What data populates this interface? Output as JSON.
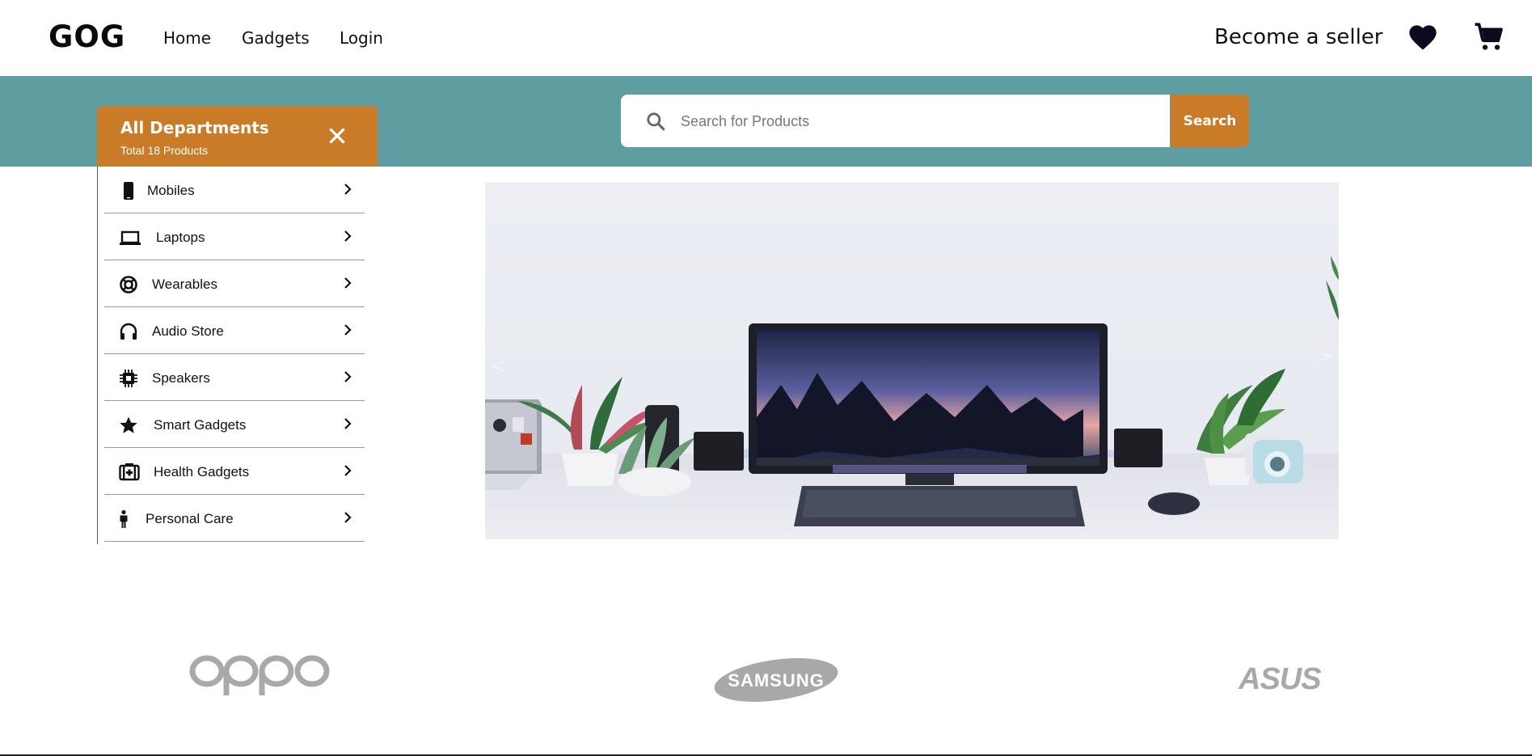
{
  "header": {
    "logo": "GOG",
    "nav": [
      {
        "label": "Home"
      },
      {
        "label": "Gadgets"
      },
      {
        "label": "Login"
      }
    ],
    "seller_label": "Become a seller",
    "icons": [
      "heart-icon",
      "cart-icon"
    ]
  },
  "departments": {
    "title": "All Departments",
    "subtitle": "Total 18 Products",
    "items": [
      {
        "label": "Mobiles",
        "icon": "mobile-icon"
      },
      {
        "label": "Laptops",
        "icon": "laptop-icon"
      },
      {
        "label": "Wearables",
        "icon": "wearable-icon"
      },
      {
        "label": "Audio Store",
        "icon": "headphones-icon"
      },
      {
        "label": "Speakers",
        "icon": "chip-icon"
      },
      {
        "label": "Smart Gadgets",
        "icon": "star-icon"
      },
      {
        "label": "Health Gadgets",
        "icon": "first-aid-icon"
      },
      {
        "label": "Personal Care",
        "icon": "person-icon"
      }
    ]
  },
  "search": {
    "placeholder": "Search for Products",
    "button_label": "Search"
  },
  "hero": {
    "prev_symbol": "<",
    "next_symbol": ">"
  },
  "brands": [
    "oppo",
    "SAMSUNG",
    "ASUS"
  ],
  "colors": {
    "accent": "#c97b27",
    "band": "#5f9ea0",
    "text": "#111111"
  }
}
